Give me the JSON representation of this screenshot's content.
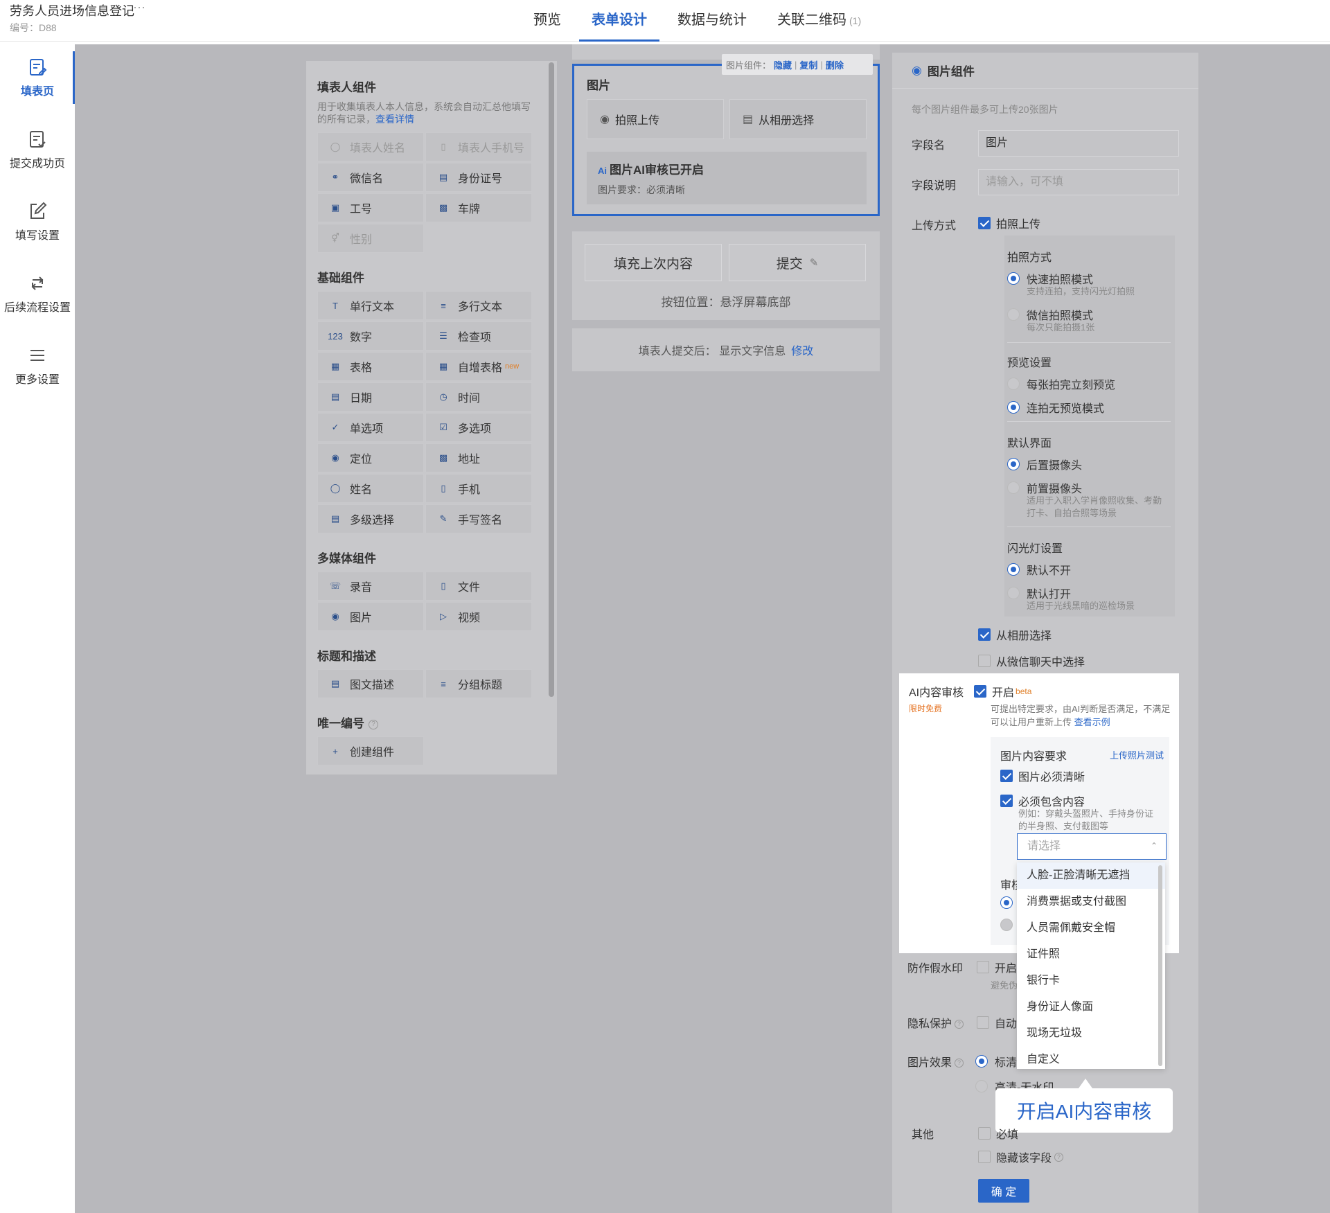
{
  "header": {
    "title": "劳务人员进场信息登记",
    "more": "···",
    "id_label": "编号：D88",
    "tabs": [
      {
        "label": "预览"
      },
      {
        "label": "表单设计"
      },
      {
        "label": "数据与统计"
      },
      {
        "label": "关联二维码",
        "count": "(1)"
      }
    ]
  },
  "sidebar": {
    "items": [
      {
        "label": "填表页"
      },
      {
        "label": "提交成功页"
      },
      {
        "label": "填写设置"
      },
      {
        "label": "后续流程设置"
      },
      {
        "label": "更多设置"
      }
    ]
  },
  "components": {
    "filler": {
      "title": "填表人组件",
      "desc": "用于收集填表人本人信息，系统会自动汇总他填写的所有记录，",
      "link": "查看详情",
      "items": [
        "填表人姓名",
        "填表人手机号",
        "微信名",
        "身份证号",
        "工号",
        "车牌",
        "性别"
      ]
    },
    "basic": {
      "title": "基础组件",
      "items": [
        "单行文本",
        "多行文本",
        "数字",
        "检查项",
        "表格",
        "自增表格",
        "日期",
        "时间",
        "单选项",
        "多选项",
        "定位",
        "地址",
        "姓名",
        "手机",
        "多级选择",
        "手写签名"
      ],
      "new_badge": "new"
    },
    "media": {
      "title": "多媒体组件",
      "items": [
        "录音",
        "文件",
        "图片",
        "视频"
      ]
    },
    "title_desc": {
      "title": "标题和描述",
      "items": [
        "图文描述",
        "分组标题"
      ]
    },
    "unique": {
      "title": "唯一编号",
      "items": [
        "创建组件"
      ]
    }
  },
  "form": {
    "image_label": "图片",
    "toolbar": {
      "prefix": "图片组件：",
      "hide": "隐藏",
      "copy": "复制",
      "delete": "删除"
    },
    "upload_camera": "拍照上传",
    "upload_album": "从相册选择",
    "ai_title": "图片AI审核已开启",
    "ai_req": "图片要求：必须清晰",
    "fill_last": "填充上次内容",
    "submit": "提交",
    "btn_position": "按钮位置：悬浮屏幕底部",
    "after_submit": "填表人提交后： 显示文字信息",
    "after_edit": "修改"
  },
  "right": {
    "title": "图片组件",
    "note": "每个图片组件最多可上传20张图片",
    "field_name_label": "字段名",
    "field_name_value": "图片",
    "field_desc_label": "字段说明",
    "field_desc_placeholder": "请输入，可不填",
    "upload_label": "上传方式",
    "camera_upload": "拍照上传",
    "photo_mode": "拍照方式",
    "quick_mode": "快速拍照模式",
    "quick_mode_sub": "支持连拍，支持闪光灯拍照",
    "wechat_mode": "微信拍照模式",
    "wechat_mode_sub": "每次只能拍摄1张",
    "preview_label": "预览设置",
    "preview_each": "每张拍完立刻预览",
    "preview_burst": "连拍无预览模式",
    "default_ui": "默认界面",
    "rear_cam": "后置摄像头",
    "front_cam": "前置摄像头",
    "front_cam_sub": "适用于入职入学肖像照收集、考勤打卡、自拍合照等场景",
    "flash_label": "闪光灯设置",
    "flash_off": "默认不开",
    "flash_on": "默认打开",
    "flash_on_sub": "适用于光线黑暗的巡检场景",
    "from_album": "从相册选择",
    "from_wechat": "从微信聊天中选择",
    "ai_label": "AI内容审核",
    "ai_free": "限时免费",
    "ai_enable": "开启",
    "ai_beta": "beta",
    "ai_desc": "可提出特定要求，由AI判断是否满足，不满足可以让用户重新上传",
    "ai_example": "查看示例",
    "content_req": "图片内容要求",
    "upload_test": "上传照片测试",
    "must_clear": "图片必须清晰",
    "must_contain": "必须包含内容",
    "must_contain_sub": "例如：穿戴头盔照片、手持身份证的半身照、支付截图等",
    "select_placeholder": "请选择",
    "audit_partial": "审核",
    "options": [
      "人脸-正脸清晰无遮挡",
      "消费票据或支付截图",
      "人员需佩戴安全帽",
      "证件照",
      "银行卡",
      "身份证人像面",
      "现场无垃圾",
      "自定义"
    ],
    "watermark_label": "防作假水印",
    "watermark_enable": "开启",
    "watermark_sub": "避免伪",
    "privacy_label": "隐私保护",
    "privacy_auto": "自动",
    "effect_label": "图片效果",
    "effect_std": "标清",
    "effect_hd": "高清-无水印",
    "other_label": "其他",
    "required": "必填",
    "hide_field": "隐藏该字段",
    "ok": "确 定"
  },
  "callout": "开启AI内容审核",
  "colors": {
    "accent": "#2a66c8",
    "overlay": "#b8b8bc",
    "free": "#e46f1c"
  }
}
